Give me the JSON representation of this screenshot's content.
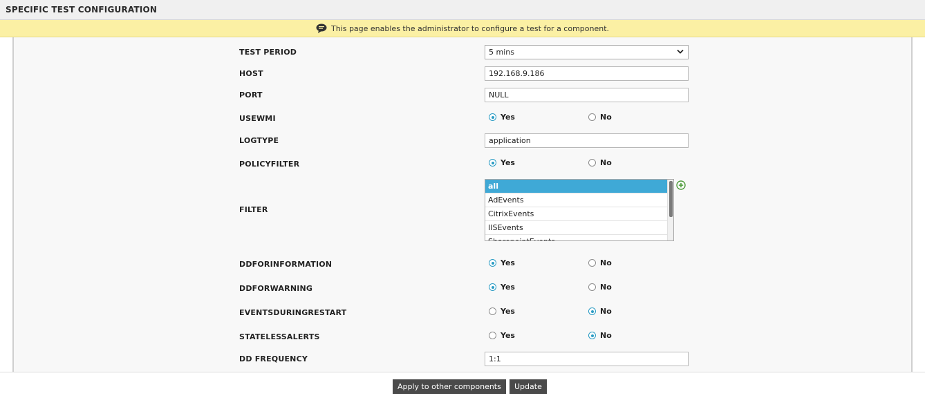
{
  "header": {
    "title": "SPECIFIC TEST CONFIGURATION"
  },
  "banner": {
    "icon": "speech-bubble-icon",
    "text": "This page enables the administrator to configure a test for a component."
  },
  "fields": {
    "test_period": {
      "label": "TEST PERIOD",
      "value": "5 mins"
    },
    "host": {
      "label": "HOST",
      "value": "192.168.9.186"
    },
    "port": {
      "label": "PORT",
      "value": "NULL"
    },
    "usewmi": {
      "label": "USEWMI",
      "yes": "Yes",
      "no": "No",
      "selected": "Yes"
    },
    "logtype": {
      "label": "LOGTYPE",
      "value": "application"
    },
    "policyfilter": {
      "label": "POLICYFILTER",
      "yes": "Yes",
      "no": "No",
      "selected": "Yes"
    },
    "filter": {
      "label": "FILTER",
      "items": [
        "all",
        "AdEvents",
        "CitrixEvents",
        "IISEvents",
        "SharepointEvents"
      ],
      "selected": "all"
    },
    "ddforinformation": {
      "label": "DDFORINFORMATION",
      "yes": "Yes",
      "no": "No",
      "selected": "Yes"
    },
    "ddforwarning": {
      "label": "DDFORWARNING",
      "yes": "Yes",
      "no": "No",
      "selected": "Yes"
    },
    "eventsduringrestart": {
      "label": "EVENTSDURINGRESTART",
      "yes": "Yes",
      "no": "No",
      "selected": "No"
    },
    "statelessalerts": {
      "label": "STATELESSALERTS",
      "yes": "Yes",
      "no": "No",
      "selected": "No"
    },
    "dd_frequency": {
      "label": "DD FREQUENCY",
      "value": "1:1"
    }
  },
  "footer": {
    "apply_label": "Apply to other components",
    "update_label": "Update"
  },
  "colors": {
    "accent": "#3fa9d6",
    "banner": "#fbf0a4",
    "button": "#4a4a4a",
    "radio": "#2c9cc4"
  }
}
